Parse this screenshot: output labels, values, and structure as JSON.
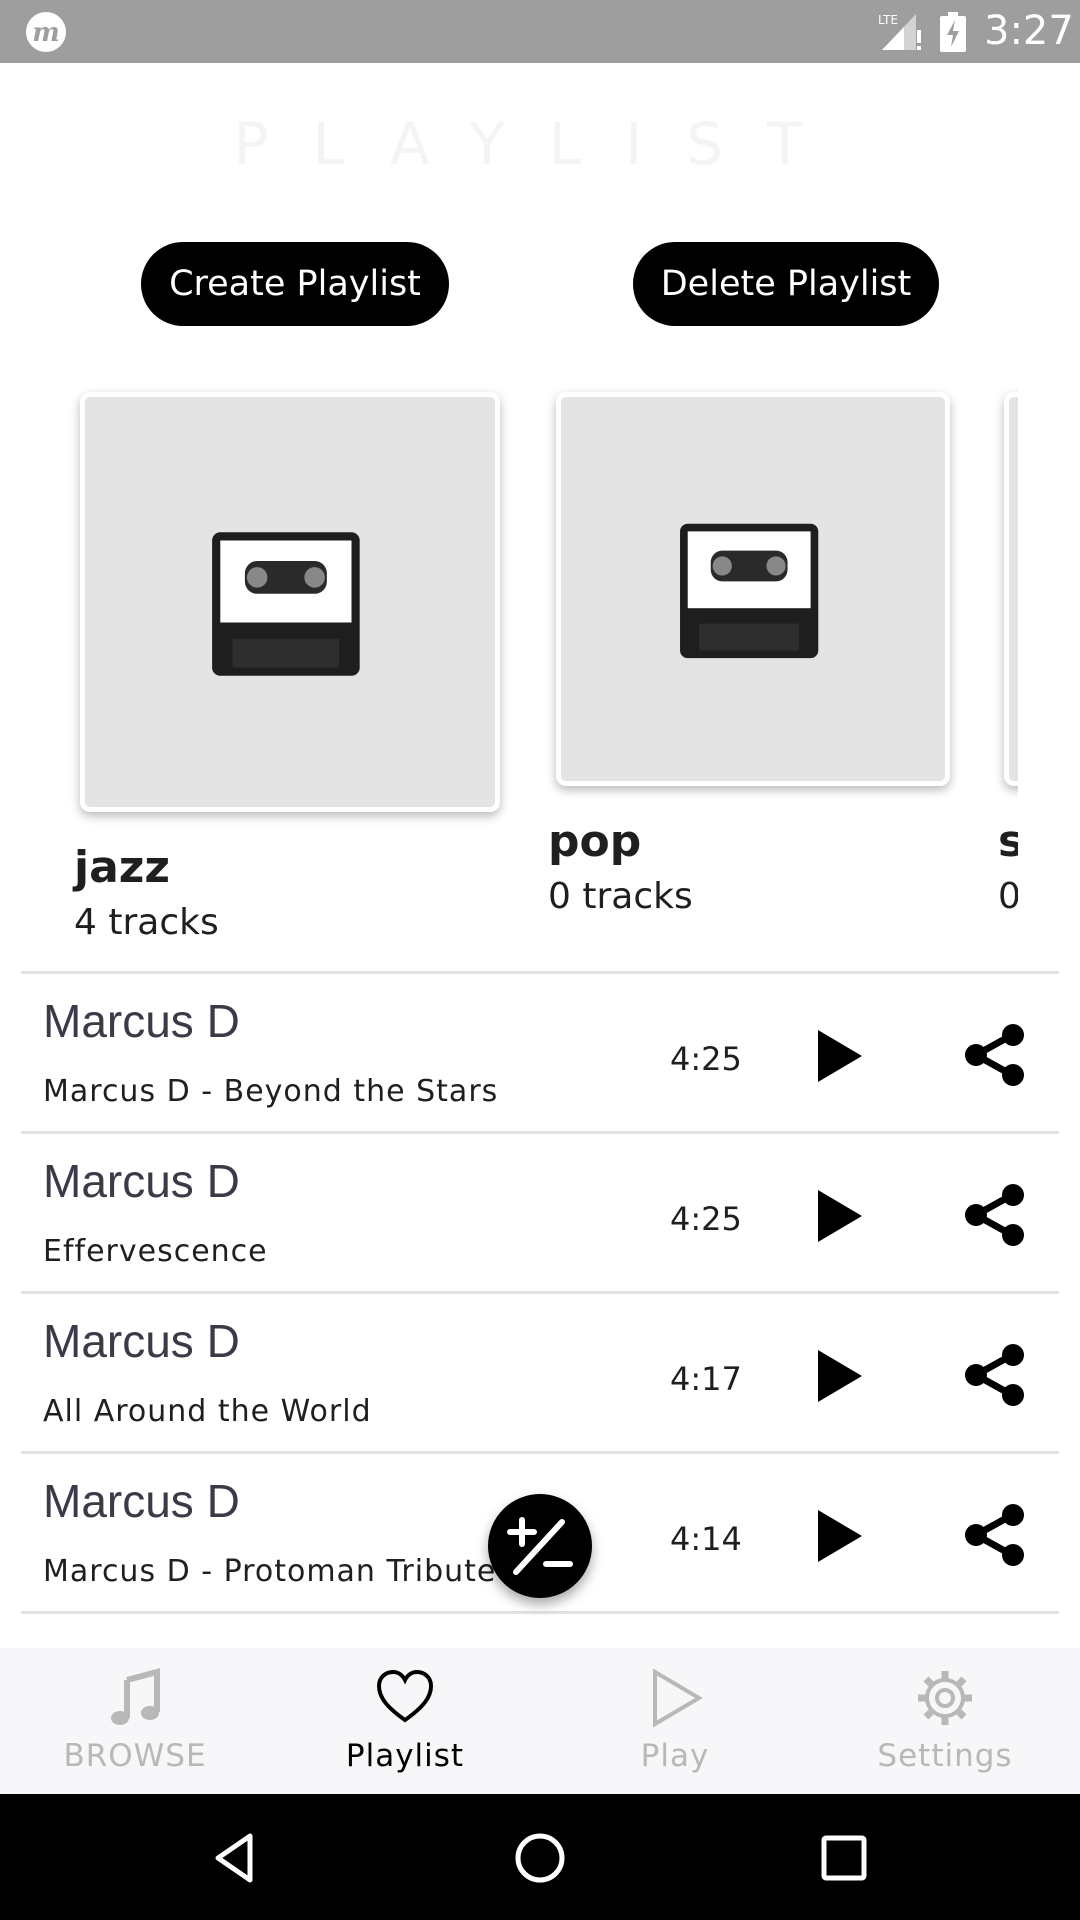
{
  "status_bar": {
    "time": "3:27",
    "network": "LTE",
    "app_icon": "m-logo-icon"
  },
  "header": {
    "title": "PLAYLIST"
  },
  "actions": {
    "create_label": "Create Playlist",
    "delete_label": "Delete Playlist"
  },
  "playlists": [
    {
      "name": "jazz",
      "count": "4 tracks"
    },
    {
      "name": "pop",
      "count": "0 tracks"
    },
    {
      "name": "s",
      "count": "0"
    }
  ],
  "tracks": [
    {
      "artist": "Marcus D",
      "title": "Marcus D - Beyond the Stars",
      "duration": "4:25"
    },
    {
      "artist": "Marcus D",
      "title": "Effervescence",
      "duration": "4:25"
    },
    {
      "artist": "Marcus D",
      "title": "All Around the World",
      "duration": "4:17"
    },
    {
      "artist": "Marcus D",
      "title": "Marcus D - Protoman Tribute",
      "duration": "4:14"
    }
  ],
  "fab": {
    "icon": "plus-minus-icon"
  },
  "bottom_nav": {
    "items": [
      {
        "label": "BROWSE",
        "icon": "music-note-icon",
        "active": false
      },
      {
        "label": "Playlist",
        "icon": "heart-icon",
        "active": true
      },
      {
        "label": "Play",
        "icon": "play-outline-icon",
        "active": false
      },
      {
        "label": "Settings",
        "icon": "gear-icon",
        "active": false
      }
    ]
  },
  "colors": {
    "status_bar": "#9e9e9e",
    "button": "#000000",
    "nav_inactive": "#b8b8b8",
    "nav_active": "#000000"
  }
}
